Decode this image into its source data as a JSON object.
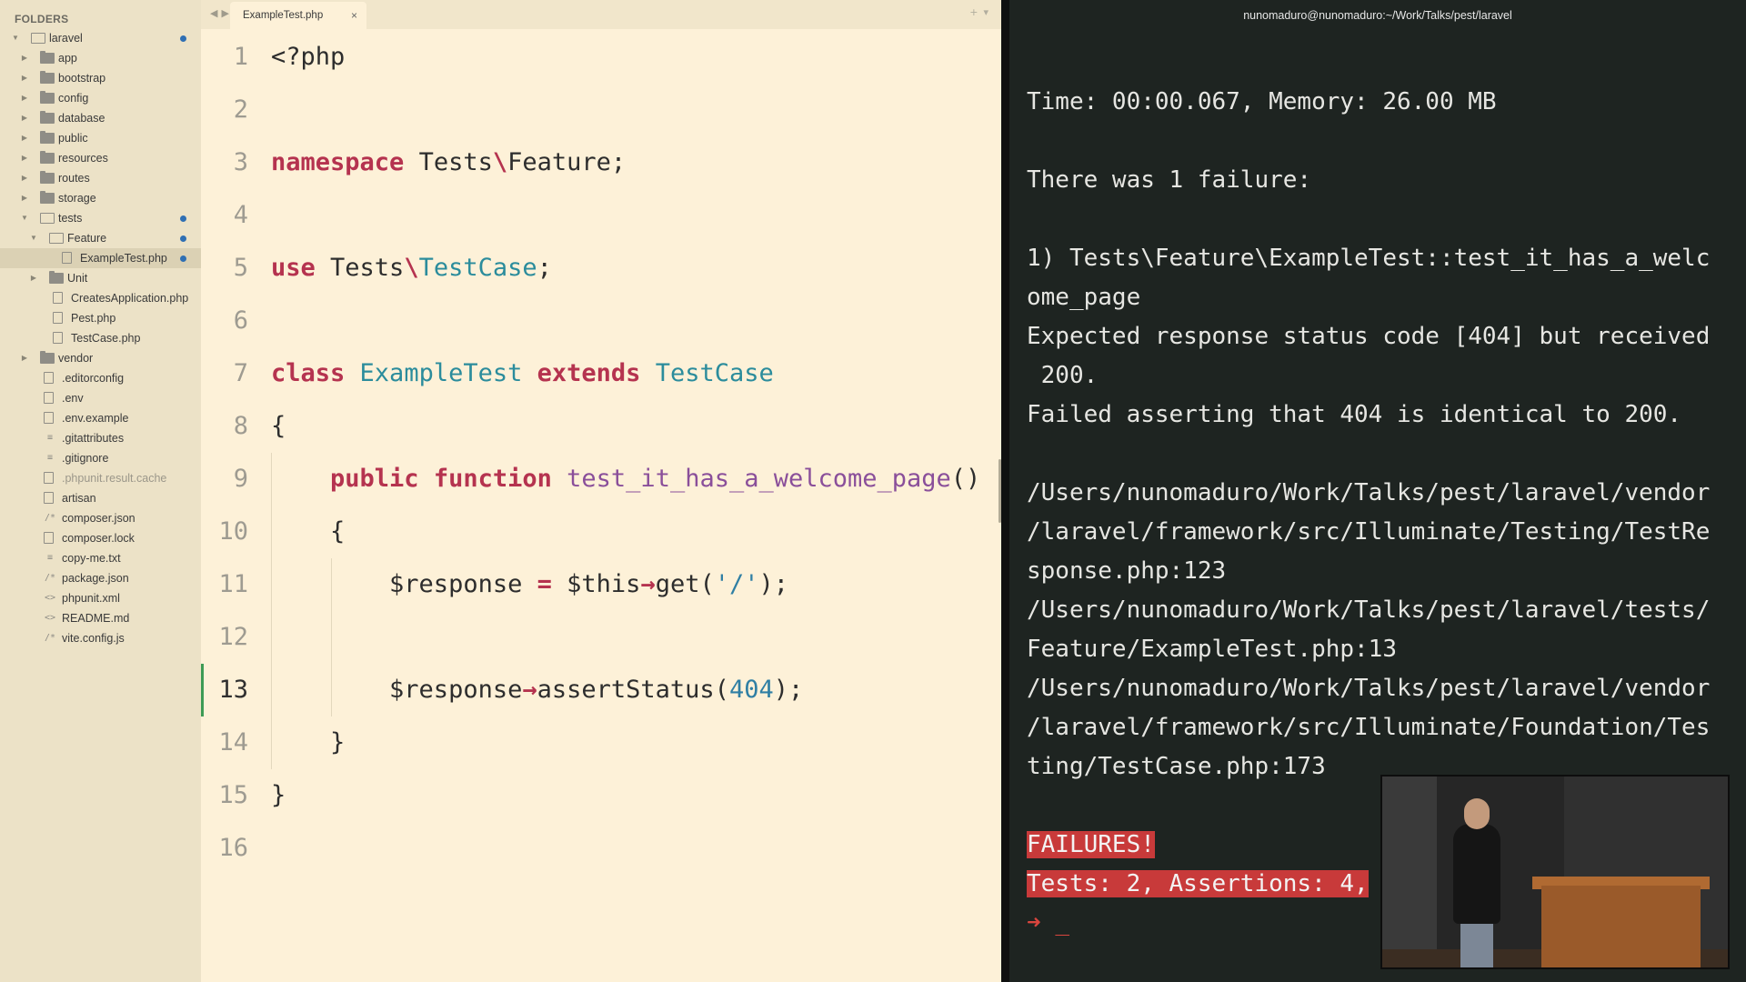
{
  "sidebar": {
    "title": "FOLDERS",
    "items": [
      {
        "label": "laravel",
        "depth": 0,
        "kind": "folder-open",
        "arrow": "down",
        "dot": true
      },
      {
        "label": "app",
        "depth": 1,
        "kind": "folder",
        "arrow": "right"
      },
      {
        "label": "bootstrap",
        "depth": 1,
        "kind": "folder",
        "arrow": "right"
      },
      {
        "label": "config",
        "depth": 1,
        "kind": "folder",
        "arrow": "right"
      },
      {
        "label": "database",
        "depth": 1,
        "kind": "folder",
        "arrow": "right"
      },
      {
        "label": "public",
        "depth": 1,
        "kind": "folder",
        "arrow": "right"
      },
      {
        "label": "resources",
        "depth": 1,
        "kind": "folder",
        "arrow": "right"
      },
      {
        "label": "routes",
        "depth": 1,
        "kind": "folder",
        "arrow": "right"
      },
      {
        "label": "storage",
        "depth": 1,
        "kind": "folder",
        "arrow": "right"
      },
      {
        "label": "tests",
        "depth": 1,
        "kind": "folder-open",
        "arrow": "down",
        "dot": true
      },
      {
        "label": "Feature",
        "depth": 2,
        "kind": "folder-open",
        "arrow": "down",
        "dot": true
      },
      {
        "label": "ExampleTest.php",
        "depth": 3,
        "kind": "file",
        "dot": true,
        "selected": true
      },
      {
        "label": "Unit",
        "depth": 2,
        "kind": "folder",
        "arrow": "right"
      },
      {
        "label": "CreatesApplication.php",
        "depth": 2,
        "kind": "file"
      },
      {
        "label": "Pest.php",
        "depth": 2,
        "kind": "file"
      },
      {
        "label": "TestCase.php",
        "depth": 2,
        "kind": "file"
      },
      {
        "label": "vendor",
        "depth": 1,
        "kind": "folder",
        "arrow": "right"
      },
      {
        "label": ".editorconfig",
        "depth": 1,
        "kind": "file"
      },
      {
        "label": ".env",
        "depth": 1,
        "kind": "file"
      },
      {
        "label": ".env.example",
        "depth": 1,
        "kind": "file"
      },
      {
        "label": ".gitattributes",
        "depth": 1,
        "kind": "list"
      },
      {
        "label": ".gitignore",
        "depth": 1,
        "kind": "list"
      },
      {
        "label": ".phpunit.result.cache",
        "depth": 1,
        "kind": "file",
        "dim": true
      },
      {
        "label": "artisan",
        "depth": 1,
        "kind": "file"
      },
      {
        "label": "composer.json",
        "depth": 1,
        "kind": "comment"
      },
      {
        "label": "composer.lock",
        "depth": 1,
        "kind": "file"
      },
      {
        "label": "copy-me.txt",
        "depth": 1,
        "kind": "list"
      },
      {
        "label": "package.json",
        "depth": 1,
        "kind": "comment"
      },
      {
        "label": "phpunit.xml",
        "depth": 1,
        "kind": "code"
      },
      {
        "label": "README.md",
        "depth": 1,
        "kind": "code"
      },
      {
        "label": "vite.config.js",
        "depth": 1,
        "kind": "comment"
      }
    ]
  },
  "editor": {
    "tab_label": "ExampleTest.php",
    "close_glyph": "×",
    "current_line": 13,
    "lines": [
      {
        "n": "1",
        "tokens": [
          [
            "t-dark",
            "<?php"
          ]
        ]
      },
      {
        "n": "2",
        "tokens": []
      },
      {
        "n": "3",
        "tokens": [
          [
            "k-red",
            "namespace"
          ],
          [
            "t-dark",
            " Tests"
          ],
          [
            "k-red",
            "\\"
          ],
          [
            "t-dark",
            "Feature;"
          ]
        ]
      },
      {
        "n": "4",
        "tokens": []
      },
      {
        "n": "5",
        "tokens": [
          [
            "k-red",
            "use"
          ],
          [
            "t-dark",
            " Tests"
          ],
          [
            "k-red",
            "\\"
          ],
          [
            "k-teal",
            "TestCase"
          ],
          [
            "t-dark",
            ";"
          ]
        ]
      },
      {
        "n": "6",
        "tokens": []
      },
      {
        "n": "7",
        "tokens": [
          [
            "k-red",
            "class"
          ],
          [
            "t-dark",
            " "
          ],
          [
            "k-teal",
            "ExampleTest"
          ],
          [
            "t-dark",
            " "
          ],
          [
            "k-red",
            "extends"
          ],
          [
            "t-dark",
            " "
          ],
          [
            "k-teal",
            "TestCase"
          ]
        ]
      },
      {
        "n": "8",
        "tokens": [
          [
            "t-dark",
            "{"
          ]
        ]
      },
      {
        "n": "9",
        "tokens": [
          [
            "t-dark",
            "    "
          ],
          [
            "k-red",
            "public"
          ],
          [
            "t-dark",
            " "
          ],
          [
            "k-red",
            "function"
          ],
          [
            "t-dark",
            " "
          ],
          [
            "k-purple",
            "test_it_has_a_welcome_page"
          ],
          [
            "t-dark",
            "()"
          ]
        ]
      },
      {
        "n": "10",
        "tokens": [
          [
            "t-dark",
            "    {"
          ]
        ]
      },
      {
        "n": "11",
        "tokens": [
          [
            "t-dark",
            "        $response "
          ],
          [
            "k-red",
            "="
          ],
          [
            "t-dark",
            " $this"
          ],
          [
            "k-red",
            "→"
          ],
          [
            "t-dark",
            "get("
          ],
          [
            "k-blue",
            "'/'"
          ],
          [
            "t-dark",
            ");"
          ]
        ]
      },
      {
        "n": "12",
        "tokens": []
      },
      {
        "n": "13",
        "tokens": [
          [
            "t-dark",
            "        $response"
          ],
          [
            "k-red",
            "→"
          ],
          [
            "t-dark",
            "assertStatus("
          ],
          [
            "k-blue",
            "404"
          ],
          [
            "t-dark",
            ");"
          ]
        ]
      },
      {
        "n": "14",
        "tokens": [
          [
            "t-dark",
            "    }"
          ]
        ]
      },
      {
        "n": "15",
        "tokens": [
          [
            "t-dark",
            "}"
          ]
        ]
      },
      {
        "n": "16",
        "tokens": []
      }
    ]
  },
  "terminal": {
    "title": "nunomaduro@nunomaduro:~/Work/Talks/pest/laravel",
    "lines": [
      "Time: 00:00.067, Memory: 26.00 MB",
      "",
      "There was 1 failure:",
      "",
      "1) Tests\\Feature\\ExampleTest::test_it_has_a_welc",
      "ome_page",
      "Expected response status code [404] but received",
      " 200.",
      "Failed asserting that 404 is identical to 200.",
      "",
      "/Users/nunomaduro/Work/Talks/pest/laravel/vendor",
      "/laravel/framework/src/Illuminate/Testing/TestRe",
      "sponse.php:123",
      "/Users/nunomaduro/Work/Talks/pest/laravel/tests/",
      "Feature/ExampleTest.php:13",
      "/Users/nunomaduro/Work/Talks/pest/laravel/vendor",
      "/laravel/framework/src/Illuminate/Foundation/Tes",
      "ting/TestCase.php:173",
      ""
    ],
    "failures_label": "FAILURES!",
    "summary_label": "Tests: 2, Assertions: 4,",
    "prompt_glyph": "➜",
    "cursor_glyph": "_"
  },
  "colors": {
    "sidebar_bg": "#ece2c7",
    "editor_bg": "#fdf1d8",
    "terminal_bg": "#1e2421",
    "keyword": "#b5334f",
    "type": "#2b8c9c",
    "function": "#8a4f9a",
    "failure_bg": "#c83a3a",
    "git_dot": "#2f6fb3"
  }
}
